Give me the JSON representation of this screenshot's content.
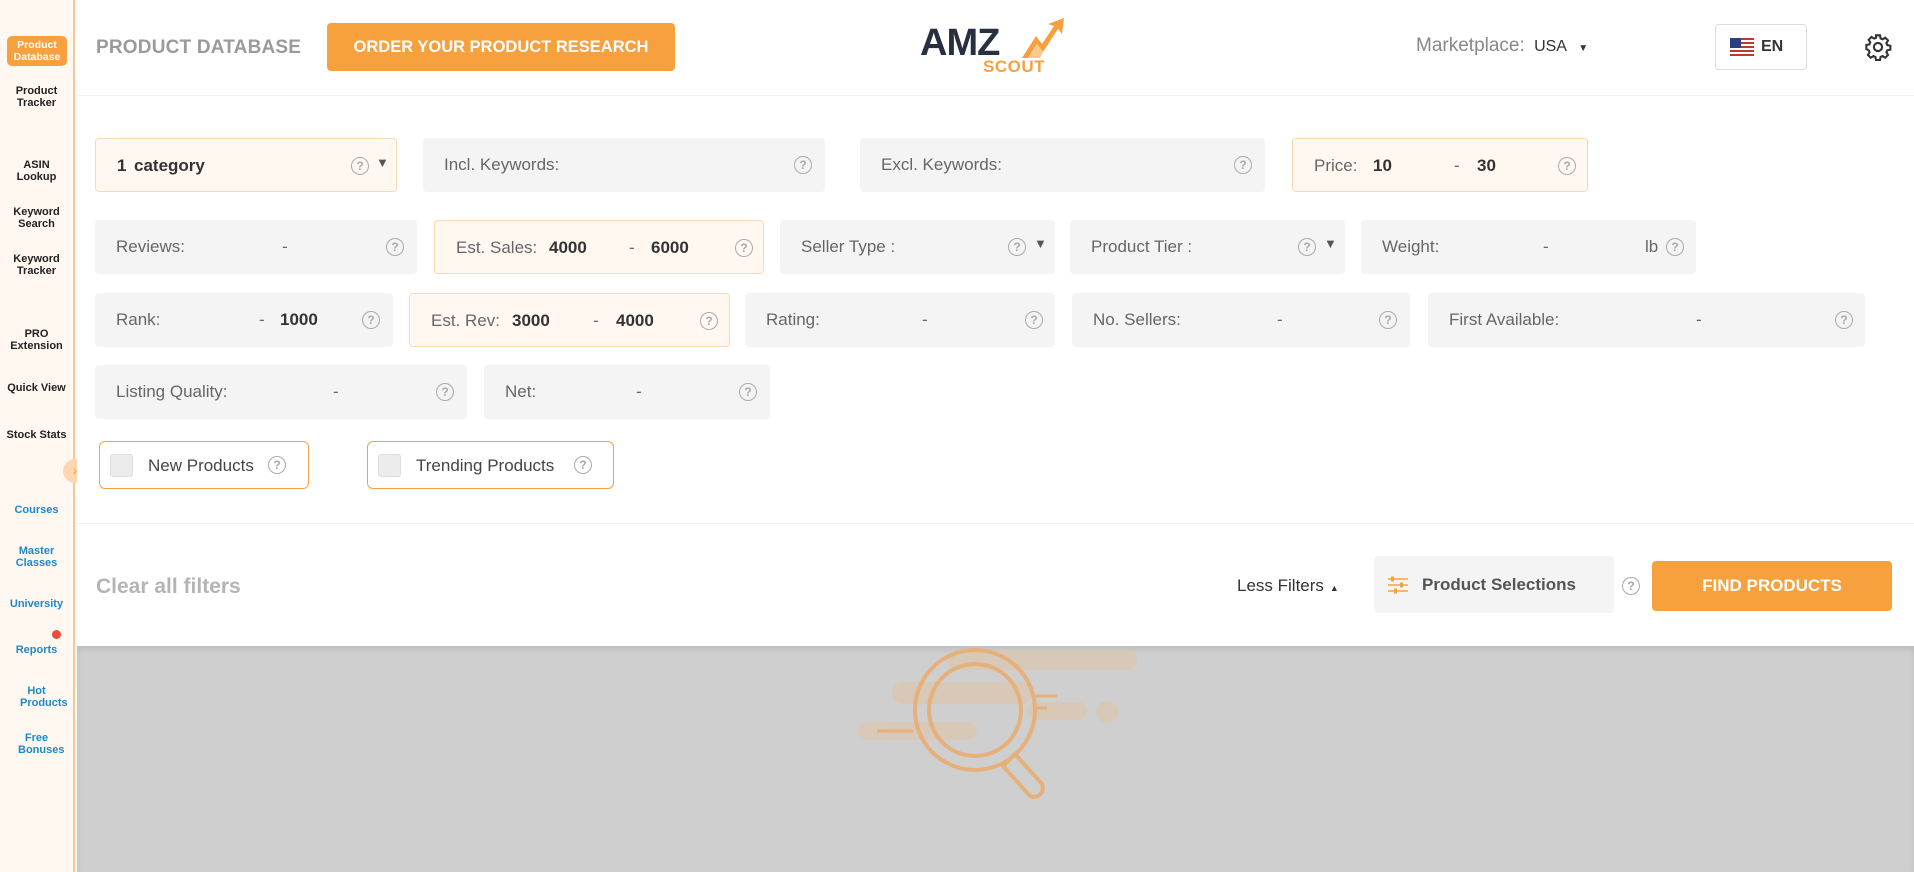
{
  "sidebar": {
    "items": [
      {
        "label": "Product Database",
        "active": true
      },
      {
        "label": "Product Tracker"
      },
      {
        "label": "ASIN Lookup"
      },
      {
        "label": "Keyword Search"
      },
      {
        "label": "Keyword Tracker"
      },
      {
        "label": "PRO Extension"
      },
      {
        "label": "Quick View"
      },
      {
        "label": "Stock Stats"
      }
    ],
    "links": [
      {
        "label": "Courses"
      },
      {
        "label": "Master Classes"
      },
      {
        "label": "University"
      },
      {
        "label": "Reports"
      },
      {
        "label": "Hot Products"
      },
      {
        "label": "Free Bonuses"
      }
    ],
    "collapse_icon": "chevron-right-icon"
  },
  "header": {
    "title": "PRODUCT DATABASE",
    "order_button": "ORDER YOUR PRODUCT RESEARCH",
    "logo_main": "AMZ",
    "logo_sub": "SCOUT",
    "marketplace_label": "Marketplace:",
    "marketplace_value": "USA",
    "language": "EN",
    "accent": "#f7a13e"
  },
  "filters": {
    "category": {
      "count": "1",
      "label": "category"
    },
    "incl_keywords": {
      "label": "Incl. Keywords:"
    },
    "excl_keywords": {
      "label": "Excl. Keywords:"
    },
    "price": {
      "label": "Price:",
      "min": "10",
      "max": "30"
    },
    "reviews": {
      "label": "Reviews:",
      "sep": "-"
    },
    "est_sales": {
      "label": "Est. Sales:",
      "min": "4000",
      "max": "6000",
      "sep": "-"
    },
    "seller_type": {
      "label": "Seller Type :"
    },
    "product_tier": {
      "label": "Product Tier :"
    },
    "weight": {
      "label": "Weight:",
      "sep": "-",
      "unit": "lb"
    },
    "rank": {
      "label": "Rank:",
      "sep": "-",
      "max": "1000"
    },
    "est_rev": {
      "label": "Est. Rev:",
      "min": "3000",
      "max": "4000",
      "sep": "-"
    },
    "rating": {
      "label": "Rating:",
      "sep": "-"
    },
    "no_sellers": {
      "label": "No. Sellers:",
      "sep": "-"
    },
    "first_available": {
      "label": "First Available:",
      "sep": "-"
    },
    "listing_quality": {
      "label": "Listing Quality:",
      "sep": "-"
    },
    "net": {
      "label": "Net:",
      "sep": "-"
    },
    "new_products": {
      "label": "New Products",
      "checked": false
    },
    "trending_products": {
      "label": "Trending Products",
      "checked": false
    },
    "help_glyph": "?",
    "dropdown_glyph": "▼"
  },
  "actions": {
    "clear": "Clear all filters",
    "less_filters": "Less Filters",
    "product_selections": "Product Selections",
    "find": "FIND PRODUCTS"
  }
}
